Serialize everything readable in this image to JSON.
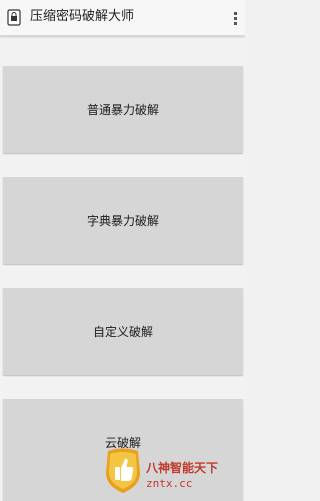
{
  "action_bar": {
    "title": "压缩密码破解大师",
    "icon": "archive-lock-icon",
    "overflow_icon": "overflow-menu-icon"
  },
  "buttons": [
    {
      "label": "普通暴力破解"
    },
    {
      "label": "字典暴力破解"
    },
    {
      "label": "自定义破解"
    },
    {
      "label": "云破解"
    }
  ],
  "watermark": {
    "logo": "thumbs-up-icon",
    "line1": "八神智能天下",
    "line2": "zntx.cc"
  },
  "colors": {
    "background": "#f2f2f2",
    "button": "#d6d6d6",
    "watermark": "#c0392b"
  }
}
